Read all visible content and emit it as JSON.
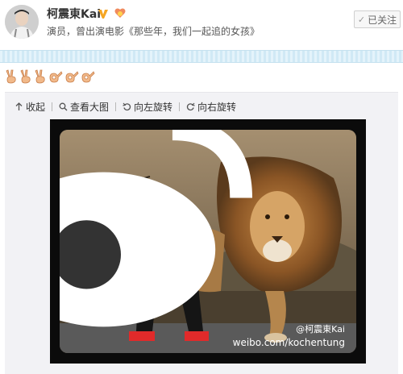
{
  "user": {
    "name": "柯震東Kai",
    "bio": "演员，曾出演电影《那些年，我们一起追的女孩》",
    "follow_label": "已关注"
  },
  "post": {
    "emojis": [
      "victory-hand-icon",
      "victory-hand-icon",
      "victory-hand-icon",
      "ok-hand-icon",
      "ok-hand-icon",
      "ok-hand-icon"
    ]
  },
  "toolbar": {
    "collapse_label": "收起",
    "view_large_label": "查看大图",
    "rotate_left_label": "向左旋转",
    "rotate_right_label": "向右旋转"
  },
  "photo": {
    "watermark_name": "@柯震東Kai",
    "watermark_url": "weibo.com/kochentung"
  },
  "colors": {
    "verify": "#f5a623",
    "stripe": "#d0e9f5",
    "panel": "#f2f2f5"
  }
}
